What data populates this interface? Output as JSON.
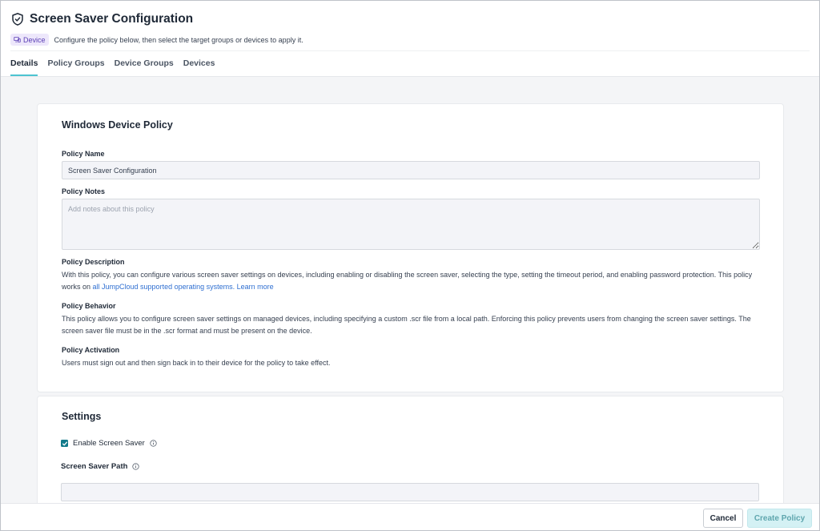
{
  "header": {
    "title": "Screen Saver Configuration",
    "badge": "Device",
    "subtitle": "Configure the policy below, then select the target groups or devices to apply it."
  },
  "tabs": [
    {
      "label": "Details",
      "active": true
    },
    {
      "label": "Policy Groups",
      "active": false
    },
    {
      "label": "Device Groups",
      "active": false
    },
    {
      "label": "Devices",
      "active": false
    }
  ],
  "policy_card": {
    "title": "Windows Device Policy",
    "policy_name_label": "Policy Name",
    "policy_name_value": "Screen Saver Configuration",
    "policy_notes_label": "Policy Notes",
    "policy_notes_placeholder": "Add notes about this policy",
    "description_label": "Policy Description",
    "description_text": "With this policy, you can configure various screen saver settings on devices, including enabling or disabling the screen saver, selecting the type, setting the timeout period, and enabling password protection. This policy works on ",
    "description_link": "all JumpCloud supported operating systems.",
    "learn_more": "Learn more",
    "behavior_label": "Policy Behavior",
    "behavior_text": "This policy allows you to configure screen saver settings on managed devices, including specifying a custom .scr file from a local path. Enforcing this policy prevents users from changing the screen saver settings. The screen saver file must be in the .scr format and must be present on the device.",
    "activation_label": "Policy Activation",
    "activation_text": "Users must sign out and then sign back in to their device for the policy to take effect."
  },
  "settings_card": {
    "title": "Settings",
    "enable_label": "Enable Screen Saver",
    "enable_checked": true,
    "path_label": "Screen Saver Path",
    "path_value": ""
  },
  "footer": {
    "cancel_label": "Cancel",
    "create_label": "Create Policy"
  },
  "colors": {
    "accent": "#4dc4d1",
    "checkbox": "#127a8a",
    "link": "#2f6fd1",
    "badge_bg": "#ede7fb",
    "badge_text": "#5b3fb5"
  }
}
